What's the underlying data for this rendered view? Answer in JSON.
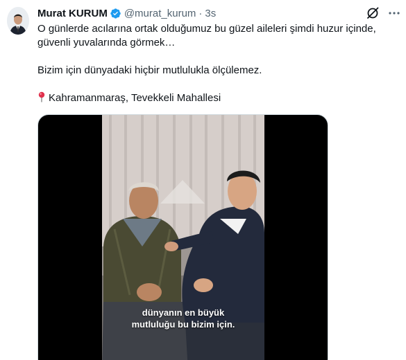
{
  "author": {
    "display_name": "Murat KURUM",
    "handle": "@murat_kurum",
    "separator": "·",
    "time": "3s",
    "verified_icon": "verified-badge-icon"
  },
  "icons": {
    "grok": "grok-icon",
    "more": "more-options-icon",
    "pin": "round-pushpin-icon"
  },
  "tweet": {
    "line1": "O günlerde acılarına ortak olduğumuz bu güzel aileleri şimdi huzur içinde, güvenli yuvalarında görmek…",
    "line2": "Bizim için dünyadaki hiçbir mutlulukla ölçülemez.",
    "location": "Kahramanmaraş, Tevekkeli Mahallesi"
  },
  "video": {
    "caption_line1": "dünyanın en büyük",
    "caption_line2": "mutluluğu bu bizim için."
  },
  "colors": {
    "text": "#0f1419",
    "muted": "#536471",
    "verified": "#1d9bf0"
  }
}
